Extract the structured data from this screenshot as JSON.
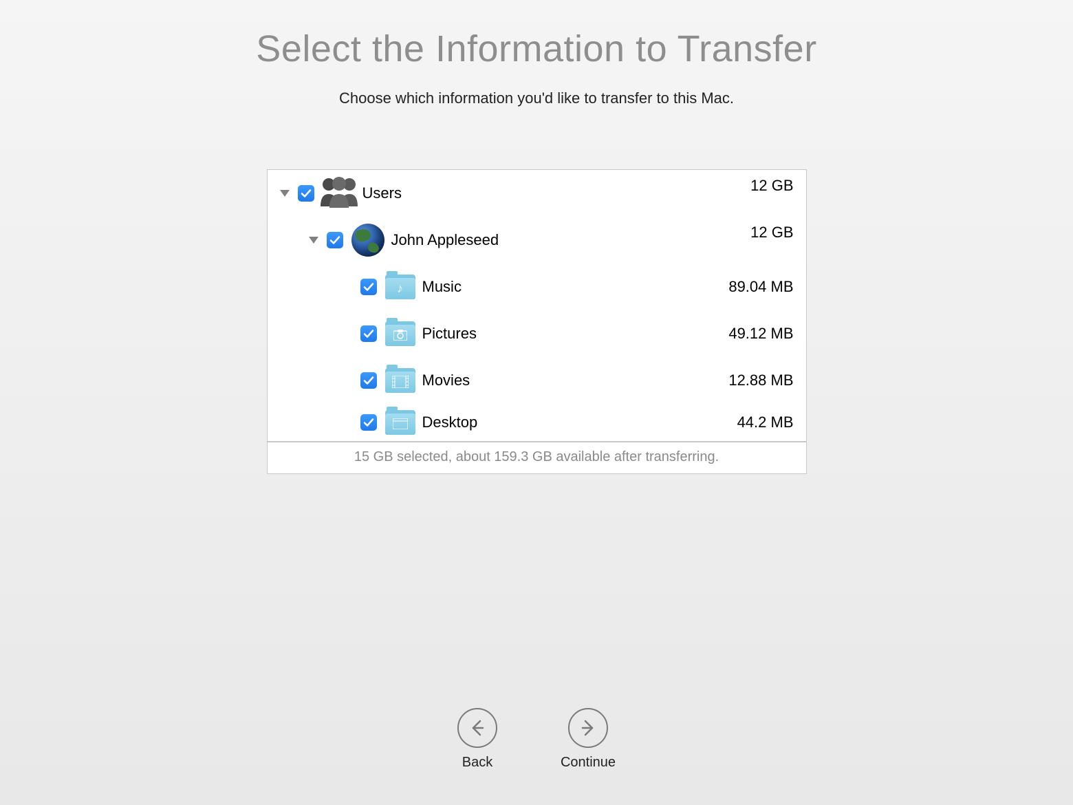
{
  "title": "Select the Information to Transfer",
  "subtitle": "Choose which information you'd like to transfer to this Mac.",
  "tree": {
    "users": {
      "label": "Users",
      "size": "12 GB",
      "checked": true,
      "expanded": true
    },
    "user0": {
      "label": "John Appleseed",
      "size": "12 GB",
      "checked": true,
      "expanded": true
    },
    "items": [
      {
        "label": "Music",
        "size": "89.04 MB",
        "checked": true,
        "icon": "music"
      },
      {
        "label": "Pictures",
        "size": "49.12 MB",
        "checked": true,
        "icon": "pictures"
      },
      {
        "label": "Movies",
        "size": "12.88 MB",
        "checked": true,
        "icon": "movies"
      },
      {
        "label": "Desktop",
        "size": "44.2 MB",
        "checked": true,
        "icon": "desktop"
      }
    ]
  },
  "status": "15 GB selected, about 159.3 GB available after transferring.",
  "nav": {
    "back": "Back",
    "continue": "Continue"
  }
}
